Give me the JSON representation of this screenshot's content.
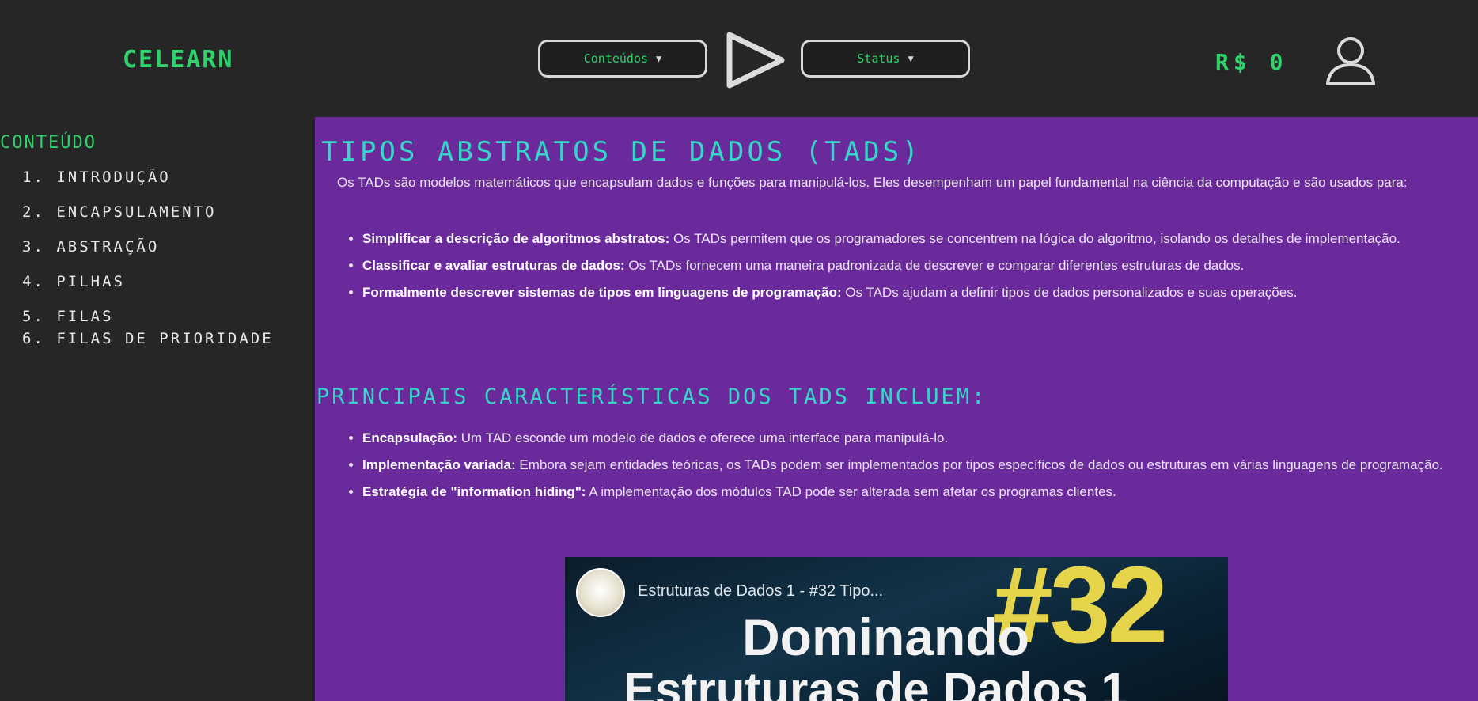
{
  "header": {
    "logo": "CELEARN",
    "conteudos_label": "Conteúdos",
    "status_label": "Status",
    "coins": "R$ 0"
  },
  "sidebar": {
    "title": "CONTEÚDO",
    "items": [
      "1. INTRODUÇÃO",
      "2. ENCAPSULAMENTO",
      "3. ABSTRAÇÃO",
      "4. PILHAS",
      "5. FILAS",
      "6. FILAS DE PRIORIDADE"
    ]
  },
  "content": {
    "title": "TIPOS ABSTRATOS DE DADOS (TADS)",
    "intro": "Os TADs são modelos matemáticos que encapsulam dados e funções para manipulá-los. Eles desempenham um papel fundamental na ciência da computação e são usados para:",
    "uses": [
      {
        "bold": "Simplificar a descrição de algoritmos abstratos:",
        "text": " Os TADs permitem que os programadores se concentrem na lógica do algoritmo, isolando os detalhes de implementação."
      },
      {
        "bold": "Classificar e avaliar estruturas de dados:",
        "text": " Os TADs fornecem uma maneira padronizada de descrever e comparar diferentes estruturas de dados."
      },
      {
        "bold": "Formalmente descrever sistemas de tipos em linguagens de programação:",
        "text": " Os TADs ajudam a definir tipos de dados personalizados e suas operações."
      }
    ],
    "subtitle": "PRINCIPAIS CARACTERÍSTICAS DOS TADS INCLUEM:",
    "features": [
      {
        "bold": "Encapsulação:",
        "text": " Um TAD esconde um modelo de dados e oferece uma interface para manipulá-lo."
      },
      {
        "bold": "Implementação variada:",
        "text": " Embora sejam entidades teóricas, os TADs podem ser implementados por tipos específicos de dados ou estruturas em várias linguagens de programação."
      },
      {
        "bold": "Estratégia de \"information hiding\":",
        "text": " A implementação dos módulos TAD pode ser alterada sem afetar os programas clientes."
      }
    ],
    "video": {
      "title": "Estruturas de Dados 1 - #32 Tipo...",
      "number": "#32",
      "line1": "Dominando",
      "line2": "Estruturas de Dados 1"
    }
  },
  "colors": {
    "accent_green": "#2fd36b",
    "heading_cyan": "#35d6c7",
    "content_purple": "#6a2a9c",
    "background": "#262626"
  },
  "icons": {
    "play": "play-icon",
    "user": "user-icon",
    "caret": "caret-down-icon"
  }
}
